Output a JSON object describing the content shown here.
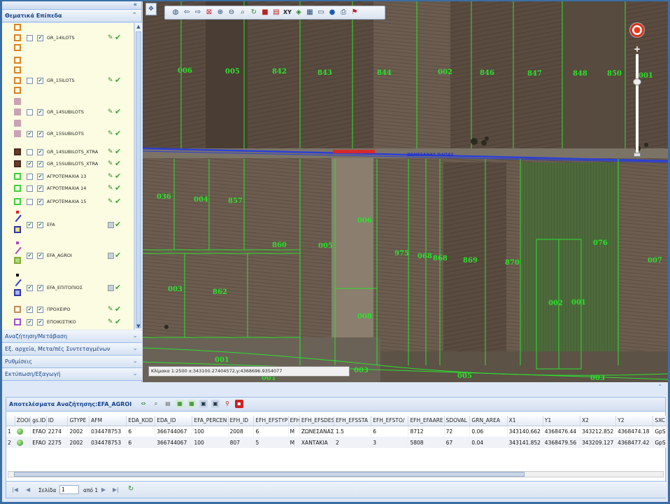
{
  "left_panel": {
    "collapse_icon": "double-chevron-up",
    "active_section": "Θεματικά Επίπεδα",
    "layers": [
      {
        "name": "GR_14ILOTS",
        "style": "square-orange-outline",
        "editable": true
      },
      {
        "name": "GR_15ILOTS",
        "style": "square-orange-outline",
        "editable": true
      },
      {
        "name": "GR_14SUBILOTS",
        "style": "square-mauve-fill",
        "editable": true
      },
      {
        "name": "GR_15SUBILOTS",
        "style": "square-mauve-fill",
        "editable": true
      },
      {
        "name": "GR_14SUBILOTS_XTRA",
        "style": "square-brown-fill",
        "editable": true
      },
      {
        "name": "GR_15SUBILOTS_XTRA",
        "style": "square-brown-fill",
        "editable": true
      },
      {
        "name": "ΑΓΡΟΤΕΜΑΧΙΑ 13",
        "style": "square-green-outline",
        "editable": true
      },
      {
        "name": "ΑΓΡΟΤΕΜΑΧΙΑ 14",
        "style": "square-green-outline",
        "editable": true
      },
      {
        "name": "ΑΓΡΟΤΕΜΑΧΙΑ 15",
        "style": "square-green-outline",
        "editable": true
      },
      {
        "name": "EFA",
        "style": "multi-red-blue-yellow",
        "editable": false
      },
      {
        "name": "EFA_AGROI",
        "style": "multi-purple-green",
        "editable": false
      },
      {
        "name": "EFA_ΕΠΙΤΟΠΙΟΣ",
        "style": "multi-black-blue",
        "editable": false
      },
      {
        "name": "ΠΡΟΧΕΙΡΟ",
        "style": "square-tan-outline",
        "editable": true
      },
      {
        "name": "ΕΠΟΙΚΙΣΤΙΚΟ",
        "style": "square-purple-outline",
        "editable": true
      }
    ],
    "sections": [
      "Αναζήτηση/Μετάβαση",
      "Εξ. αρχεία, Μετα/πές Συντεταγμένων",
      "Ρυθμίσεις",
      "Εκτύπωση/Εξαγωγή"
    ]
  },
  "map": {
    "coords_text": "Κλίμακα 1:2500 x:343100.27404572,y:4368696.9354077",
    "road_label": "ΖΩΝΕΣΑΝΑΣ ΠΑΠΑΣ",
    "parcels": [
      {
        "label": "006"
      },
      {
        "label": "005"
      },
      {
        "label": "842"
      },
      {
        "label": "843"
      },
      {
        "label": "844"
      },
      {
        "label": "002"
      },
      {
        "label": "846"
      },
      {
        "label": "847"
      },
      {
        "label": "848"
      },
      {
        "label": "850"
      },
      {
        "label": "001"
      },
      {
        "label": "036"
      },
      {
        "label": "004"
      },
      {
        "label": "857"
      },
      {
        "label": "006"
      },
      {
        "label": "860"
      },
      {
        "label": "005"
      },
      {
        "label": "975"
      },
      {
        "label": "068"
      },
      {
        "label": "868"
      },
      {
        "label": "869"
      },
      {
        "label": "870"
      },
      {
        "label": "076"
      },
      {
        "label": "007"
      },
      {
        "label": "003"
      },
      {
        "label": "862"
      },
      {
        "label": "008"
      },
      {
        "label": "002"
      },
      {
        "label": "001"
      },
      {
        "label": "001"
      },
      {
        "label": "003"
      },
      {
        "label": "001"
      },
      {
        "label": "005"
      },
      {
        "label": "003"
      }
    ],
    "toolbar_tools": [
      "globe",
      "back",
      "forward",
      "zoom-extent",
      "zoom-in",
      "zoom-out",
      "zoom-box",
      "refresh",
      "layer",
      "select",
      "xy",
      "measure",
      "grid",
      "ruler",
      "globe2",
      "print",
      "info"
    ]
  },
  "results": {
    "title": "Αποτελέσματα Αναζήτησης:EFA_AGROI",
    "columns": [
      "",
      "ZOOI",
      "gs.ID",
      "ID",
      "GTYPE",
      "AFM",
      "EDA_KOD",
      "EDA_ID",
      "EFA_PERCEN",
      "EFH_ID",
      "EFH_EFSTYP",
      "EFH",
      "EFH_EFSDES",
      "EFH_EFSSTA",
      "EFH_EFSTO/",
      "EFH_EFAARE",
      "SDOVAL",
      "GRN_AREA",
      "X1",
      "Y1",
      "X2",
      "Y2",
      "SXC"
    ],
    "rows": [
      [
        "1",
        "",
        "EFAOI",
        "2274",
        "2002",
        "034478753",
        "6",
        "366744067",
        "100",
        "2008",
        "6",
        "M",
        "ΖΩΝΕΣΑΝΑΣ",
        "1.5",
        "6",
        "8712",
        "72",
        "0.06",
        "343140.662",
        "4368476.44",
        "343212.852",
        "4368474.18",
        "GpS"
      ],
      [
        "2",
        "",
        "EFAOI",
        "2275",
        "2002",
        "034478753",
        "6",
        "366744067",
        "100",
        "807",
        "5",
        "M",
        "ΧΑΝΤΑΚΙΑ",
        "2",
        "3",
        "5808",
        "67",
        "0.04",
        "343141.852",
        "4368479.56",
        "343209.127",
        "4368477.42",
        "GpS"
      ]
    ],
    "pager": {
      "page_label": "Σελίδα",
      "page_value": "1",
      "of_label": "από 1"
    }
  }
}
